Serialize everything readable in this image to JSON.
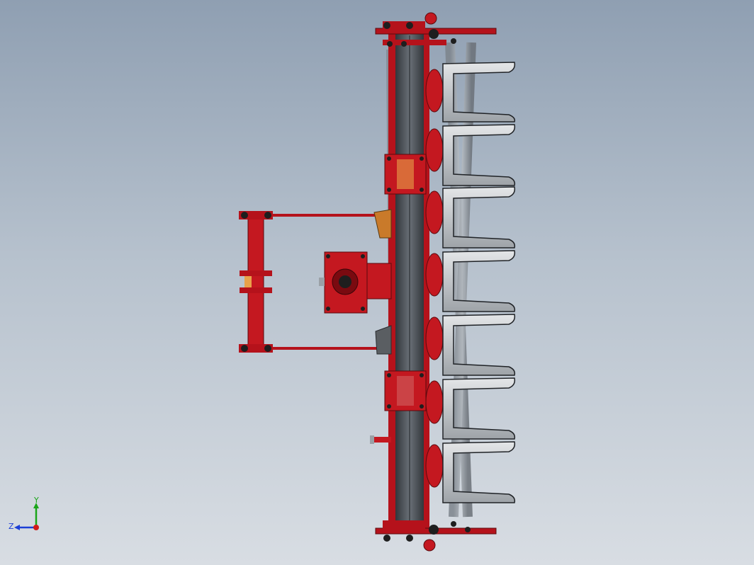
{
  "viewport": {
    "background_top": "#8f9fb2",
    "background_bottom": "#d8dde3"
  },
  "model": {
    "frame_color": "#b5121b",
    "steel_color": "#3a3f44",
    "blade_color": "#bfc2c6",
    "blade_count": 7
  },
  "triad": {
    "y_label": "Y",
    "z_label": "Z",
    "y_color": "#1aa51a",
    "z_color": "#1c3fd6",
    "x_color": "#d11a1a"
  }
}
